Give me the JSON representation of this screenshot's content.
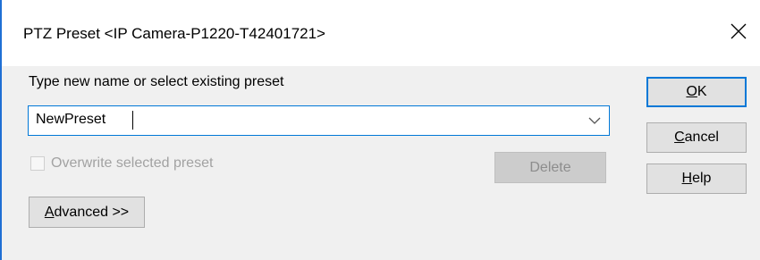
{
  "window": {
    "title": "PTZ Preset <IP Camera-P1220-T42401721>",
    "close_glyph": "✕"
  },
  "form": {
    "prompt": "Type new name or select existing preset",
    "preset_value": "NewPreset",
    "overwrite_label": "Overwrite selected preset",
    "overwrite_checked": false,
    "overwrite_enabled": false
  },
  "buttons": {
    "ok": {
      "mnemonic": "O",
      "rest": "K"
    },
    "cancel": {
      "mnemonic": "C",
      "rest": "ancel"
    },
    "help": {
      "mnemonic": "H",
      "rest": "elp"
    },
    "delete": {
      "label": "Delete",
      "enabled": false
    },
    "advanced": {
      "mnemonic": "A",
      "rest": "dvanced >>"
    }
  },
  "colors": {
    "accent": "#0078d7",
    "dialog_background": "#f0f0f0",
    "disabled_text": "#a2a2a2"
  },
  "icons": {
    "close": "close-icon",
    "dropdown": "chevron-down-icon"
  }
}
